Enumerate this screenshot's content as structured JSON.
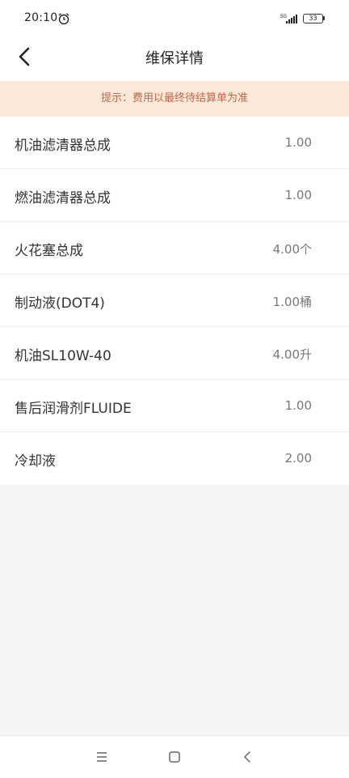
{
  "status_bar": {
    "time": "20:10",
    "network": "5G",
    "battery": "33"
  },
  "header": {
    "title": "维保详情"
  },
  "notice": {
    "text": "提示：费用以最终待结算单为准"
  },
  "items": [
    {
      "name": "机油滤清器总成",
      "quantity": "1.00"
    },
    {
      "name": "燃油滤清器总成",
      "quantity": "1.00"
    },
    {
      "name": "火花塞总成",
      "quantity": "4.00个"
    },
    {
      "name": "制动液(DOT4)",
      "quantity": "1.00桶"
    },
    {
      "name": "机油SL10W-40",
      "quantity": "4.00升"
    },
    {
      "name": "售后润滑剂FLUIDE",
      "quantity": "1.00"
    },
    {
      "name": "冷却液",
      "quantity": "2.00"
    }
  ],
  "icons": {
    "back": "back-arrow-icon",
    "alarm": "alarm-clock-icon",
    "signal": "signal-icon",
    "battery": "battery-icon",
    "menu": "menu-icon",
    "home": "home-icon",
    "system_back": "back-icon"
  }
}
